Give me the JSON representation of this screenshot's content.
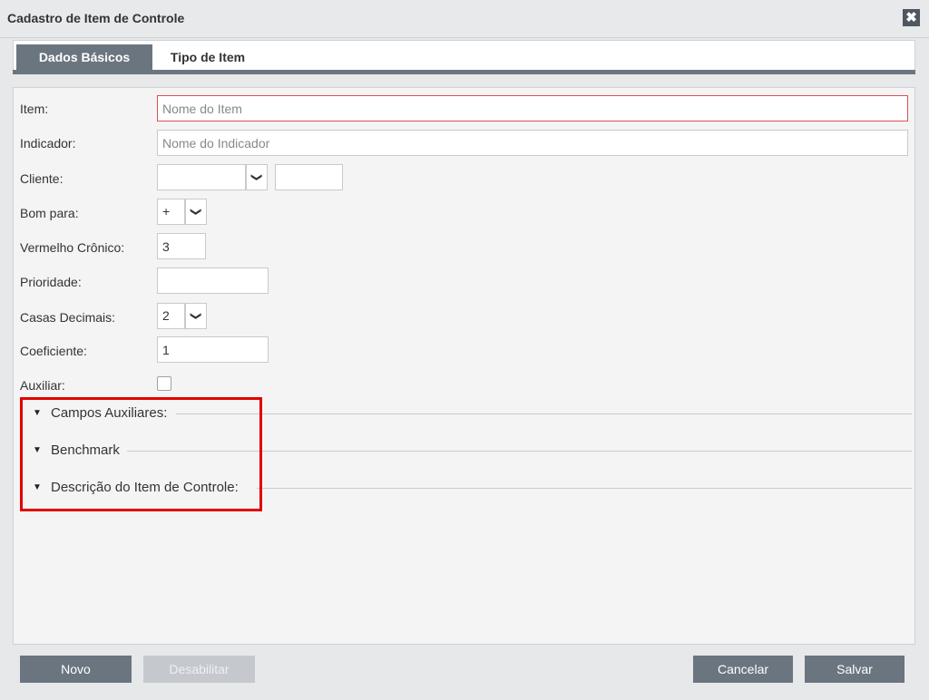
{
  "window": {
    "title": "Cadastro de Item de Controle",
    "close_label": "✖"
  },
  "tabs": [
    {
      "label": "Dados Básicos",
      "active": true
    },
    {
      "label": "Tipo de Item",
      "active": false
    }
  ],
  "form": {
    "item": {
      "label": "Item:",
      "value": "",
      "placeholder": "Nome do Item"
    },
    "indicador": {
      "label": "Indicador:",
      "value": "",
      "placeholder": "Nome do Indicador"
    },
    "cliente": {
      "label": "Cliente:",
      "value": "",
      "code": ""
    },
    "bom_para": {
      "label": "Bom para:",
      "value": "+"
    },
    "vermelho_cronico": {
      "label": "Vermelho Crônico:",
      "value": "3"
    },
    "prioridade": {
      "label": "Prioridade:",
      "value": ""
    },
    "casas_decimais": {
      "label": "Casas Decimais:",
      "value": "2"
    },
    "coeficiente": {
      "label": "Coeficiente:",
      "value": "1"
    },
    "auxiliar": {
      "label": "Auxiliar:",
      "checked": false
    }
  },
  "sections": [
    {
      "title": "Campos Auxiliares:",
      "expanded": false
    },
    {
      "title": "Benchmark",
      "expanded": false
    },
    {
      "title": "Descrição do Item de Controle:",
      "expanded": false
    }
  ],
  "icons": {
    "caret": "▼",
    "dropdown": "❯"
  },
  "buttons": {
    "novo": "Novo",
    "desabilitar": "Desabilitar",
    "cancelar": "Cancelar",
    "salvar": "Salvar"
  },
  "colors": {
    "accent": "#6b7580",
    "highlight": "#e10000",
    "error_border": "#d9534f"
  }
}
